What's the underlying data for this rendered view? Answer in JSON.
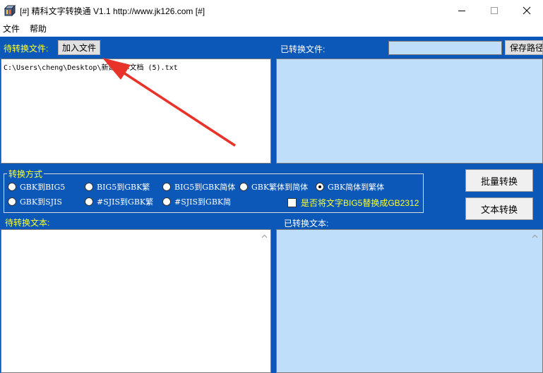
{
  "window": {
    "title": "[#] 精科文字转换通 V1.1  http://www.jk126.com [#]",
    "min_label": "─",
    "max_label": "☐",
    "close_label": "✕"
  },
  "menu": {
    "items": [
      {
        "label": "文件"
      },
      {
        "label": "帮助"
      }
    ]
  },
  "source_files": {
    "label": "待转换文件:",
    "add_button": "加入文件",
    "entries": [
      "C:\\Users\\cheng\\Desktop\\新建文本文档 (5).txt"
    ]
  },
  "converted_files": {
    "label": "已转换文件:",
    "save_path_value": "",
    "save_path_button": "保存路径"
  },
  "conversion_mode": {
    "legend": "转换方式",
    "options": [
      {
        "label": "GBK到BIG5",
        "selected": false
      },
      {
        "label": "BIG5到GBK繁",
        "selected": false
      },
      {
        "label": "BIG5到GBK简体",
        "selected": false
      },
      {
        "label": "GBK繁体到简体",
        "selected": false
      },
      {
        "label": "GBK简体到繁体",
        "selected": true
      },
      {
        "label": "GBK到SJIS",
        "selected": false
      },
      {
        "label": "#SJIS到GBK繁",
        "selected": false
      },
      {
        "label": "#SJIS到GBK简",
        "selected": false
      }
    ],
    "checkbox_label": "是否将文字BIG5替换成GB2312",
    "checkbox_checked": false
  },
  "actions": {
    "batch_convert": "批量转换",
    "text_convert": "文本转换"
  },
  "source_text": {
    "label": "待转换文本:",
    "value": ""
  },
  "converted_text": {
    "label": "已转换文本:",
    "value": ""
  },
  "colors": {
    "client_bg": "#0b58b8",
    "highlight_label": "#ffff33",
    "output_area": "#bfdefa",
    "annotation_arrow": "#e8332a"
  }
}
